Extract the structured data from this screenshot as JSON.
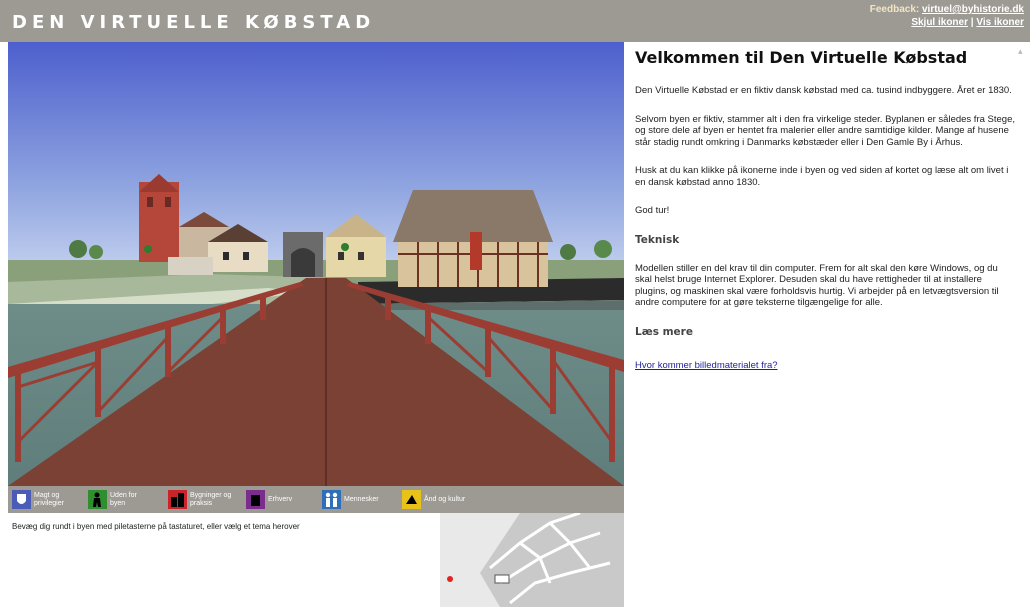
{
  "header": {
    "title": "DEN VIRTUELLE KØBSTAD",
    "feedback_label": "Feedback:",
    "feedback_email": "virtuel@byhistorie.dk",
    "hide_icons": "Skjul ikoner",
    "separator": "|",
    "show_icons": "Vis ikoner"
  },
  "iconbar": {
    "items": [
      {
        "label": "Magt og privilegier",
        "icon": "coat-of-arms-icon",
        "color": "#4a5cb8"
      },
      {
        "label": "Uden for byen",
        "icon": "farmer-icon",
        "color": "#2f8f2f"
      },
      {
        "label": "Bygninger og praksis",
        "icon": "buildings-icon",
        "color": "#c8242a"
      },
      {
        "label": "Erhverv",
        "icon": "trade-icon",
        "color": "#7a2d8c"
      },
      {
        "label": "Mennesker",
        "icon": "people-icon",
        "color": "#2f6fb8"
      },
      {
        "label": "Ånd og kultur",
        "icon": "culture-icon",
        "color": "#e8c21a"
      }
    ]
  },
  "hint": "Bevæg dig rundt i byen med piletasterne på tastaturet, eller vælg et tema herover",
  "content": {
    "title": "Velkommen til Den Virtuelle Købstad",
    "p1": "Den Virtuelle Købstad er en fiktiv dansk købstad med ca. tusind indbyggere. Året er 1830.",
    "p2": "Selvom byen er fiktiv, stammer alt i den fra virkelige steder. Byplanen er således fra Stege, og store dele af byen er hentet fra malerier eller andre samtidige kilder. Mange af husene står stadig rundt omkring i Danmarks købstæder eller i Den Gamle By i Århus.",
    "p3": "Husk at du kan klikke på ikonerne inde i byen og ved siden af kortet og læse alt om livet i en dansk købstad anno 1830.",
    "p4": "God tur!",
    "h_teknisk": "Teknisk",
    "p5": "Modellen stiller en del krav til din computer. Frem for alt skal den køre Windows, og du skal helst bruge Internet Explorer. Desuden skal du have rettigheder til at installere plugins, og maskinen skal være forholdsvis hurtig. Vi arbejder på en letvægtsversion til andre computere for at gøre teksterne tilgængelige for alle.",
    "h_laes": "Læs mere",
    "link": "Hvor kommer billedmaterialet fra?"
  }
}
